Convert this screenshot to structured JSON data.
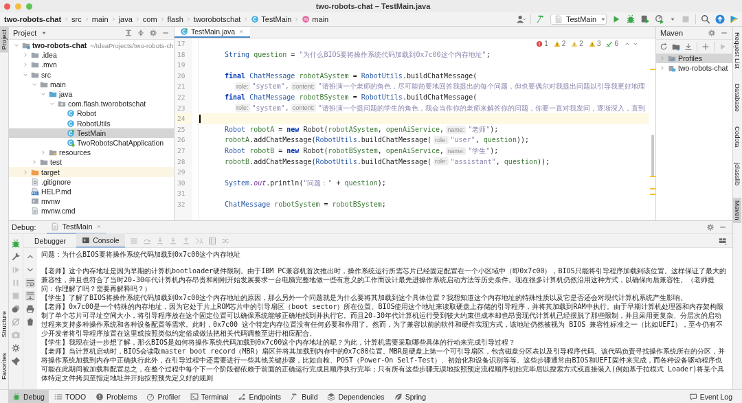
{
  "window": {
    "title": "two-robots-chat – TestMain.java"
  },
  "breadcrumbs": [
    {
      "label": "two-robots-chat",
      "kind": "project"
    },
    {
      "label": "src",
      "kind": "folder"
    },
    {
      "label": "main",
      "kind": "folder"
    },
    {
      "label": "java",
      "kind": "folder"
    },
    {
      "label": "com",
      "kind": "folder"
    },
    {
      "label": "flash",
      "kind": "folder"
    },
    {
      "label": "tworobotschat",
      "kind": "folder"
    },
    {
      "label": "TestMain",
      "kind": "class"
    },
    {
      "label": "main",
      "kind": "method"
    }
  ],
  "toolbar": {
    "run_config": "TestMain"
  },
  "left_stripe": {
    "top": [
      {
        "label": "Project",
        "selected": true
      }
    ],
    "bottom": [
      {
        "label": "Structure",
        "selected": false
      },
      {
        "label": "Favorites",
        "selected": false
      }
    ]
  },
  "project_panel": {
    "title": "Project",
    "tree": [
      {
        "label": "two-robots-chat",
        "path": "~/IdeaProjects/two-robots-ch",
        "kind": "module",
        "expanded": true,
        "selected": false,
        "children": [
          {
            "label": ".idea",
            "kind": "folder",
            "expanded": false,
            "selected": false
          },
          {
            "label": ".mvn",
            "kind": "folder",
            "expanded": false,
            "selected": false
          },
          {
            "label": "src",
            "kind": "folder",
            "expanded": true,
            "selected": false,
            "children": [
              {
                "label": "main",
                "kind": "folder",
                "expanded": true,
                "selected": false,
                "children": [
                  {
                    "label": "java",
                    "kind": "source",
                    "expanded": true,
                    "selected": false,
                    "children": [
                      {
                        "label": "com.flash.tworobotschat",
                        "kind": "package",
                        "expanded": true,
                        "selected": false,
                        "children": [
                          {
                            "label": "Robot",
                            "kind": "class",
                            "selected": false
                          },
                          {
                            "label": "RobotUtils",
                            "kind": "class",
                            "selected": false
                          },
                          {
                            "label": "TestMain",
                            "kind": "runnable",
                            "selected": true
                          },
                          {
                            "label": "TwoRobotsChatApplication",
                            "kind": "app",
                            "selected": false
                          }
                        ]
                      }
                    ]
                  },
                  {
                    "label": "resources",
                    "kind": "resources",
                    "expanded": false,
                    "selected": false
                  }
                ]
              },
              {
                "label": "test",
                "kind": "folder",
                "expanded": false,
                "selected": false
              }
            ]
          },
          {
            "label": "target",
            "kind": "excluded",
            "expanded": false,
            "selected": false
          },
          {
            "label": ".gitignore",
            "kind": "ignore",
            "selected": false
          },
          {
            "label": "HELP.md",
            "kind": "markdown",
            "selected": false
          },
          {
            "label": "mvnw",
            "kind": "script",
            "selected": false
          },
          {
            "label": "mvnw.cmd",
            "kind": "textfile",
            "selected": false
          }
        ]
      }
    ]
  },
  "editor": {
    "tabs": [
      {
        "label": "TestMain.java",
        "selected": true
      }
    ],
    "inspections": [
      {
        "kind": "error",
        "count": "1"
      },
      {
        "kind": "warning",
        "count": "2"
      },
      {
        "kind": "weak",
        "count": "2"
      },
      {
        "kind": "warning",
        "count": "3"
      },
      {
        "kind": "ok",
        "count": "6"
      }
    ],
    "lines": [
      {
        "number": "17",
        "kind": "blank",
        "current": false
      },
      {
        "number": "18",
        "kind": "code",
        "current": false,
        "tokens": [
          {
            "kind": "type",
            "text": "String "
          },
          {
            "kind": "var",
            "text": "question"
          },
          {
            "kind": "plain",
            "text": " = "
          },
          {
            "kind": "string",
            "text": "\"为什么BIOS要将操作系统代码加载到0x7c00这个内存地址\""
          },
          {
            "kind": "plain",
            "text": ";"
          }
        ]
      },
      {
        "number": "19",
        "kind": "blank",
        "current": false
      },
      {
        "number": "20",
        "kind": "code",
        "current": false,
        "tokens": [
          {
            "kind": "keyword",
            "text": "final "
          },
          {
            "kind": "type",
            "text": "ChatMessage "
          },
          {
            "kind": "var",
            "text": "robotASystem"
          },
          {
            "kind": "plain",
            "text": " = "
          },
          {
            "kind": "type",
            "text": "RobotUtils"
          },
          {
            "kind": "plain",
            "text": ".buildChatMessage("
          }
        ]
      },
      {
        "number": "21",
        "kind": "continuation",
        "current": false,
        "tokens": [
          {
            "kind": "hint",
            "text": "role:"
          },
          {
            "kind": "string",
            "text": "\"system\","
          },
          {
            "kind": "hint",
            "text": "content:"
          },
          {
            "kind": "string",
            "text": "\"请扮演一个老师的角色，尽可能简要地回答我提出的每个问题，但也要偶尔对我提出问题以引导我更好地理"
          }
        ]
      },
      {
        "number": "22",
        "kind": "code",
        "current": false,
        "tokens": [
          {
            "kind": "keyword",
            "text": "final "
          },
          {
            "kind": "type",
            "text": "ChatMessage "
          },
          {
            "kind": "var",
            "text": "robotBSystem"
          },
          {
            "kind": "plain",
            "text": " = "
          },
          {
            "kind": "type",
            "text": "RobotUtils"
          },
          {
            "kind": "plain",
            "text": ".buildChatMessage("
          }
        ]
      },
      {
        "number": "23",
        "kind": "continuation",
        "current": false,
        "tokens": [
          {
            "kind": "hint",
            "text": "role:"
          },
          {
            "kind": "string",
            "text": "\"system\","
          },
          {
            "kind": "hint",
            "text": "content:"
          },
          {
            "kind": "string",
            "text": "\"请扮演一个提问题的学生的角色，我会当作你的老师来解答你的问题，你要一直对我发问，逐渐深入，直到"
          }
        ]
      },
      {
        "number": "24",
        "kind": "blank",
        "current": true
      },
      {
        "number": "25",
        "kind": "code",
        "current": false,
        "tokens": [
          {
            "kind": "type",
            "text": "Robot "
          },
          {
            "kind": "var",
            "text": "robotA"
          },
          {
            "kind": "plain",
            "text": " = "
          },
          {
            "kind": "keyword",
            "text": "new "
          },
          {
            "kind": "plain",
            "text": "Robot("
          },
          {
            "kind": "var",
            "text": "robotASystem"
          },
          {
            "kind": "plain",
            "text": ", "
          },
          {
            "kind": "var",
            "text": "openAiService"
          },
          {
            "kind": "plain",
            "text": ","
          },
          {
            "kind": "hint",
            "text": "name:"
          },
          {
            "kind": "string",
            "text": "\"老师\""
          },
          {
            "kind": "plain",
            "text": ");"
          }
        ]
      },
      {
        "number": "26",
        "kind": "code",
        "current": false,
        "tokens": [
          {
            "kind": "var",
            "text": "robotA"
          },
          {
            "kind": "plain",
            "text": ".addChatMessage("
          },
          {
            "kind": "type",
            "text": "RobotUtils"
          },
          {
            "kind": "plain",
            "text": ".buildChatMessage("
          },
          {
            "kind": "hint",
            "text": "role:"
          },
          {
            "kind": "string",
            "text": "\"user\""
          },
          {
            "kind": "plain",
            "text": ", "
          },
          {
            "kind": "var",
            "text": "question"
          },
          {
            "kind": "plain",
            "text": "));"
          }
        ]
      },
      {
        "number": "27",
        "kind": "code",
        "current": false,
        "tokens": [
          {
            "kind": "type",
            "text": "Robot "
          },
          {
            "kind": "var",
            "text": "robotB"
          },
          {
            "kind": "plain",
            "text": " = "
          },
          {
            "kind": "keyword",
            "text": "new "
          },
          {
            "kind": "plain",
            "text": "Robot("
          },
          {
            "kind": "var",
            "text": "robotBSystem"
          },
          {
            "kind": "plain",
            "text": ", "
          },
          {
            "kind": "var",
            "text": "openAiService"
          },
          {
            "kind": "plain",
            "text": ","
          },
          {
            "kind": "hint",
            "text": "name:"
          },
          {
            "kind": "string",
            "text": "\"学生\""
          },
          {
            "kind": "plain",
            "text": ");"
          }
        ]
      },
      {
        "number": "28",
        "kind": "code",
        "current": false,
        "tokens": [
          {
            "kind": "var",
            "text": "robotB"
          },
          {
            "kind": "plain",
            "text": ".addChatMessage("
          },
          {
            "kind": "type",
            "text": "RobotUtils"
          },
          {
            "kind": "plain",
            "text": ".buildChatMessage("
          },
          {
            "kind": "hint",
            "text": "role:"
          },
          {
            "kind": "string",
            "text": "\"assistant\""
          },
          {
            "kind": "plain",
            "text": ", "
          },
          {
            "kind": "var",
            "text": "question"
          },
          {
            "kind": "plain",
            "text": "));"
          }
        ]
      },
      {
        "number": "29",
        "kind": "blank",
        "current": false
      },
      {
        "number": "30",
        "kind": "code",
        "current": false,
        "tokens": [
          {
            "kind": "type",
            "text": "System"
          },
          {
            "kind": "plain",
            "text": "."
          },
          {
            "kind": "static",
            "text": "out"
          },
          {
            "kind": "plain",
            "text": ".println("
          },
          {
            "kind": "string",
            "text": "\"问题：\""
          },
          {
            "kind": "plain",
            "text": " + "
          },
          {
            "kind": "var",
            "text": "question"
          },
          {
            "kind": "plain",
            "text": ");"
          }
        ]
      },
      {
        "number": "31",
        "kind": "blank",
        "current": false
      },
      {
        "number": "32",
        "kind": "code",
        "current": false,
        "tokens": [
          {
            "kind": "type",
            "text": "ChatMessage "
          },
          {
            "kind": "var",
            "text": "robotSystem"
          },
          {
            "kind": "plain",
            "text": " = "
          },
          {
            "kind": "var",
            "text": "robotBSystem"
          },
          {
            "kind": "plain",
            "text": ";"
          }
        ]
      }
    ]
  },
  "maven": {
    "title": "Maven",
    "tree": [
      {
        "label": "Profiles",
        "kind": "profiles",
        "selected": true
      },
      {
        "label": "two-robots-chat",
        "kind": "module",
        "selected": false
      }
    ]
  },
  "right_stripe": [
    {
      "label": "Request List",
      "selected": false
    },
    {
      "label": "Database",
      "selected": false
    },
    {
      "label": "Codota",
      "selected": false
    },
    {
      "label": "jclasslib",
      "selected": false
    },
    {
      "label": "Maven",
      "selected": true
    }
  ],
  "debug": {
    "label": "Debug:",
    "session": "TestMain",
    "tabs": [
      {
        "label": "Debugger",
        "selected": false
      },
      {
        "label": "Console",
        "selected": true
      }
    ],
    "console": [
      {
        "kind": "output",
        "text": "问题：为什么BIOS要将操作系统代码加载到0x7c00这个内存地址"
      },
      {
        "kind": "blank"
      },
      {
        "kind": "output",
        "text": "【老师】这个内存地址是因为早期的计算机bootloader硬件限制。由于IBM PC兼容机首次推出时，操作系统运行所需芯片已经固定配置在一个小区域中（即0x7c00），BIOS只能将引导程序加载到该位置。这样保证了最大的兼容性，并且也符合了当时20-30年代计算机内存昂贵和刚刚开始发展要求一台电脑完整地做一些有意义的工作而设计最先进操作系统启动方法等历史条件。现在很多计算机仍然沿用这种方式，以确保向后兼容性。（老师提问：你理解了吗？需要再解释吗？）"
      },
      {
        "kind": "output",
        "text": "【学生】了解了BIOS将操作系统代码加载到0x7c00这个内存地址的原因，那么另外一个问题就是为什么要将其加载到这个具体位置？我想知道这个内存地址的特殊性质以及它是否还会对现代计算机系统产生影响。"
      },
      {
        "kind": "output",
        "text": "【老师】0x7c00是一个特殊的内存地址，因为它处于片上ROM芯片中的引导扇区（boot sector）所在位置。BIOS使用这个地址来读取硬盘上存储的引导程序，并将其加载到RAM中执行。由于早期计算机处理器和内存架构限制了单个芯片可寻址空间大小，将引导程序放在这个固定位置可以确保系统能够正确地找到并执行它。而且20-30年代计算机运行受到较大约束但成本却也昂贵现代计算机已经摆脱了那些限制，并且采用更复杂、分层次的启动过程来支持多种操作系统和各种设备配置等需求。此时，0x7c00 这个特定内存位置没有任何必要和作用了。然而，为了兼容以前的软件和硬件实现方式，该地址仍然被视为 BIOS 兼容性标准之一（比如UEFI），至今仍有不少开发者将引导程序放置在这里或按照类似约定俗成做法把相关代码调整至进行相应配合。"
      },
      {
        "kind": "output",
        "text": "【学生】我现在进一步想了解，那么BIOS是如何将操作系统代码加载到0x7c00这个内存地址的呢？为此，计算机需要采取哪些具体的行动来完成引导过程？"
      },
      {
        "kind": "output",
        "text": "【老师】当计算机启动时，BIOS会读取master boot record（MBR）扇区并将其加载到内存中的0x7c00位置。MBR是硬盘上第一个可引导扇区，包含磁盘分区表以及引导程序代码。该代码负责寻找操作系统所在的分区，并将操作系统加载到内存中正确执行此外，在引导过程中还需要进行一些其他关键步骤，比如自检、POST（Power-On Self-Test）、初始化和设备识别等等。这些步骤通常由BIOS和UEFI固件来完成，而各种设备驱动程序也可能在此期间被加载和配置总之，在整个过程中每个下一个阶段都依赖于前面的正确运行完成且顺序执行完毕；只有所有这些步骤无误地按照预定流程顺序初始完毕后以搜索方式或直接装入(例如基于拉模式 Loader)将某个具体特定文件拷贝至指定地址并开始按照预先定义好的规则"
      }
    ]
  },
  "bottom_bar": {
    "tools": [
      {
        "label": "Debug",
        "kind": "debug",
        "selected": true
      },
      {
        "label": "TODO",
        "kind": "todo",
        "selected": false
      },
      {
        "label": "Problems",
        "kind": "problems",
        "selected": false
      },
      {
        "label": "Profiler",
        "kind": "profiler",
        "selected": false
      },
      {
        "label": "Terminal",
        "kind": "terminal",
        "selected": false
      },
      {
        "label": "Endpoints",
        "kind": "endpoints",
        "selected": false
      },
      {
        "label": "Build",
        "kind": "build",
        "selected": false
      },
      {
        "label": "Dependencies",
        "kind": "dependencies",
        "selected": false
      },
      {
        "label": "Spring",
        "kind": "spring",
        "selected": false
      }
    ],
    "event_log": "Event Log"
  }
}
